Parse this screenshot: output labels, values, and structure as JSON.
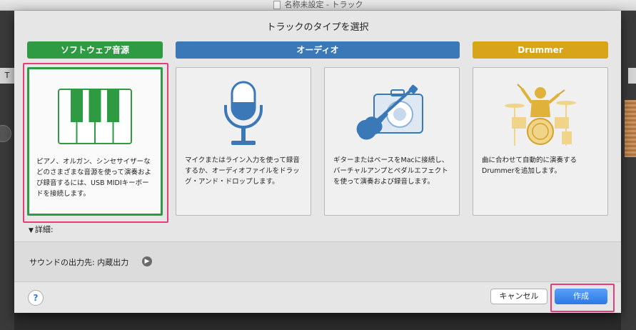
{
  "window": {
    "title": "名称未設定 - トラック"
  },
  "background": {
    "track_button_label": "T"
  },
  "dialog": {
    "title": "トラックのタイプを選択",
    "categories": [
      {
        "label": "ソフトウェア音源",
        "color": "#2e9b43"
      },
      {
        "label": "オーディオ",
        "color": "#3a78b8"
      },
      {
        "label": "Drummer",
        "color": "#d8a41a"
      }
    ],
    "cards": [
      {
        "icon": "piano-keyboard-icon",
        "selected": true,
        "description": "ピアノ、オルガン、シンセサイザーなどのさまざまな音源を使って演奏および録音するには、USB MIDIキーボードを接続します。"
      },
      {
        "icon": "microphone-icon",
        "selected": false,
        "description": "マイクまたはライン入力を使って録音するか、オーディオファイルをドラッグ・アンド・ドロップします。"
      },
      {
        "icon": "guitar-amp-icon",
        "selected": false,
        "description": "ギターまたはベースをMacに接続し、バーチャルアンプとペダルエフェクトを使って演奏および録音します。"
      },
      {
        "icon": "drummer-icon",
        "selected": false,
        "description": "曲に合わせて自動的に演奏するDrummerを追加します。"
      }
    ],
    "details_label": "詳細:",
    "output": {
      "label": "サウンドの出力先: 内蔵出力"
    },
    "help_label": "?",
    "cancel_label": "キャンセル",
    "create_label": "作成"
  },
  "colors": {
    "highlight": "#e83d78",
    "accent_blue": "#2d78e6"
  }
}
